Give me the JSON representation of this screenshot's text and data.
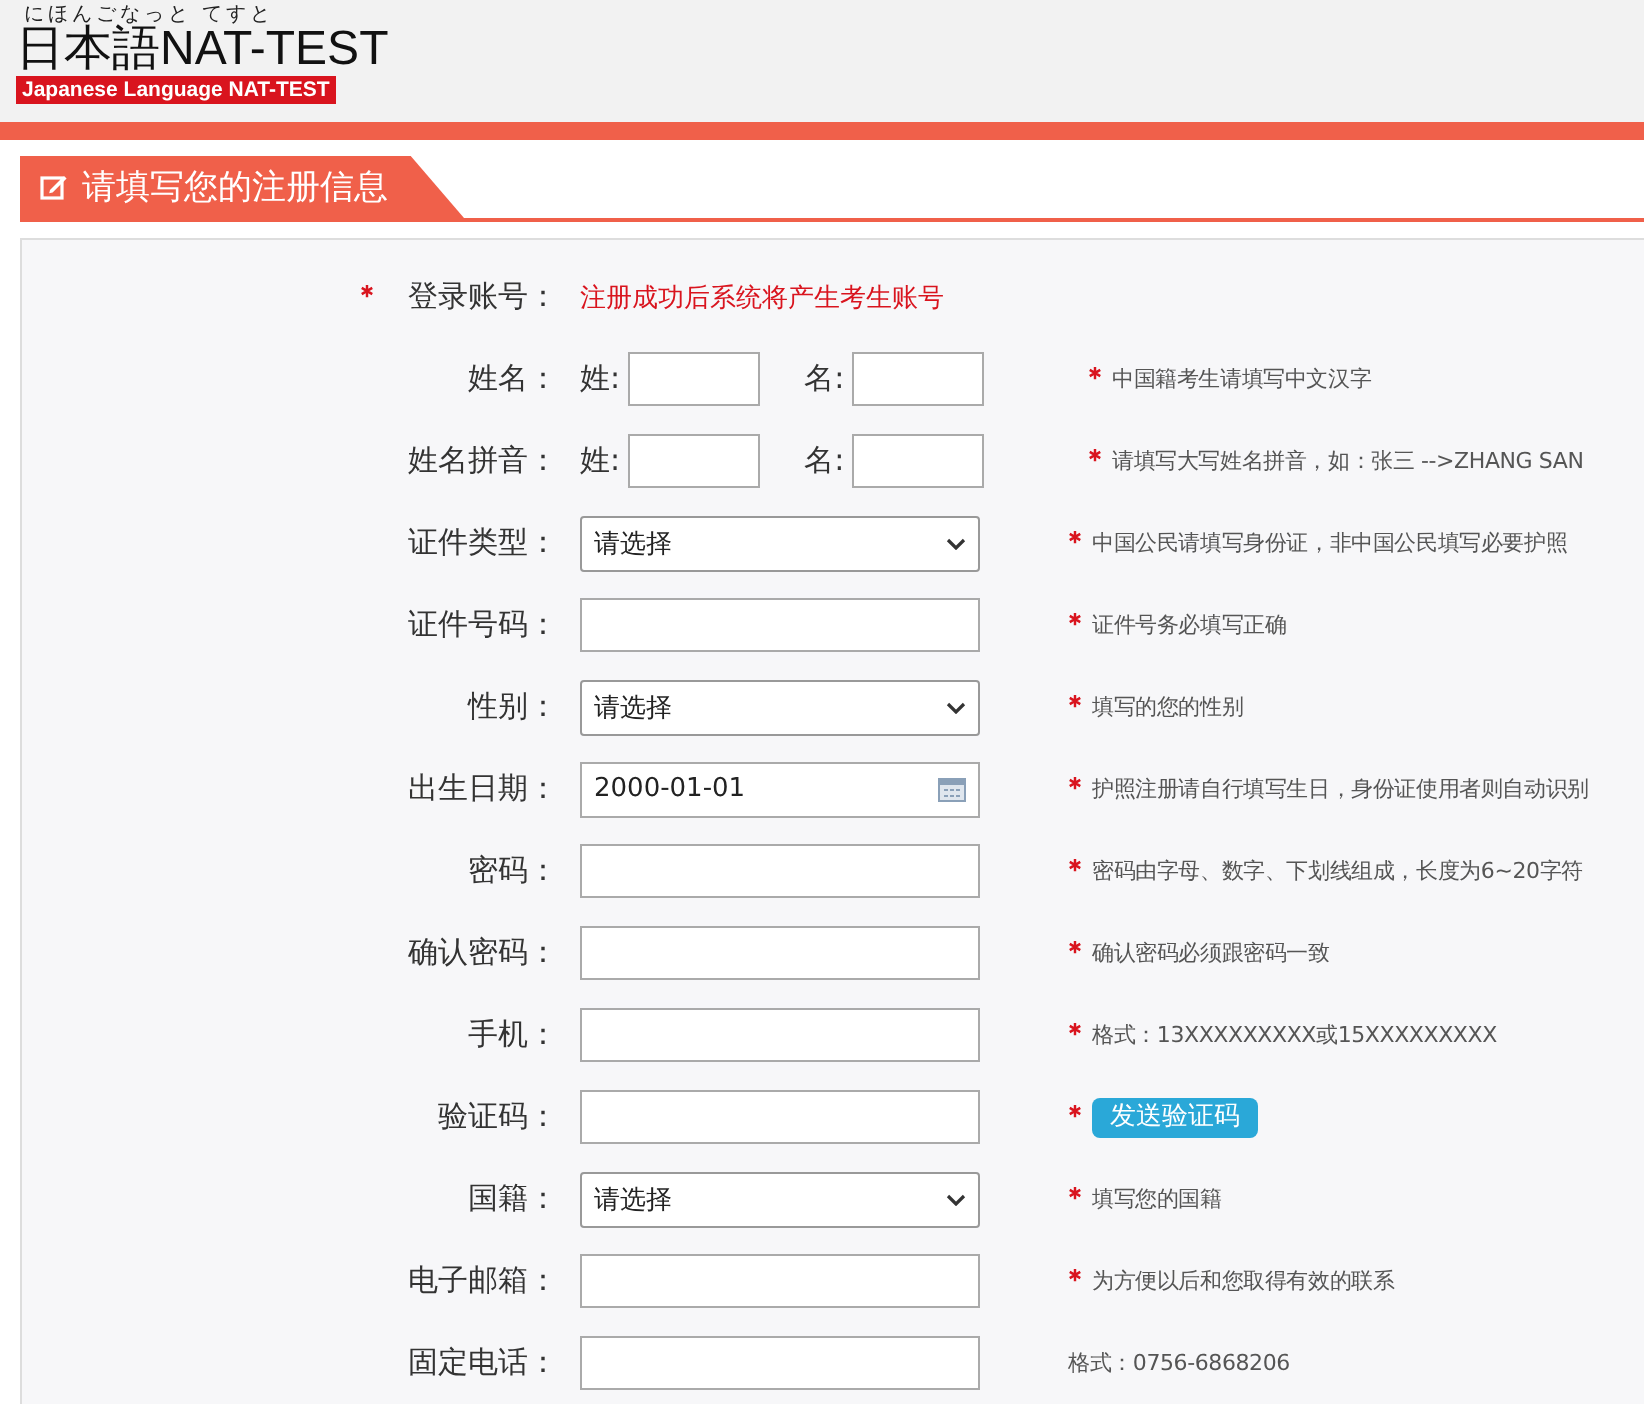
{
  "logo": {
    "ruby": "にほんごなっと てすと",
    "title": "日本語NAT-TEST",
    "subtitle": "Japanese Language NAT-TEST"
  },
  "section": {
    "title": "请填写您的注册信息"
  },
  "rows": [
    {
      "kind": "note",
      "label": "登录账号：",
      "starred": true,
      "note": "注册成功后系统将产生考生账号"
    },
    {
      "kind": "name",
      "label": "姓名：",
      "first": "姓:",
      "last": "名:",
      "hint": {
        "text": "中国籍考生请填写中文汉字",
        "required": true
      }
    },
    {
      "kind": "name",
      "label": "姓名拼音：",
      "first": "姓:",
      "last": "名:",
      "hint": {
        "text": "请填写大写姓名拼音，如：张三 -->ZHANG SAN",
        "required": true
      }
    },
    {
      "kind": "select",
      "label": "证件类型：",
      "value": "请选择",
      "hint": {
        "text": "中国公民请填写身份证，非中国公民填写必要护照",
        "required": true
      }
    },
    {
      "kind": "text",
      "label": "证件号码：",
      "hint": {
        "text": "证件号务必填写正确",
        "required": true
      }
    },
    {
      "kind": "select",
      "label": "性别：",
      "value": "请选择",
      "hint": {
        "text": "填写的您的性别",
        "required": true
      }
    },
    {
      "kind": "date",
      "label": "出生日期：",
      "value": "2000-01-01",
      "hint": {
        "text": "护照注册请自行填写生日，身份证使用者则自动识别",
        "required": true
      }
    },
    {
      "kind": "text",
      "label": "密码：",
      "hint": {
        "text": "密码由字母、数字、下划线组成，长度为6~20字符",
        "required": true
      }
    },
    {
      "kind": "text",
      "label": "确认密码：",
      "hint": {
        "text": "确认密码必须跟密码一致",
        "required": true
      }
    },
    {
      "kind": "text",
      "label": "手机：",
      "hint": {
        "text": "格式：13XXXXXXXXX或15XXXXXXXXX",
        "required": true
      }
    },
    {
      "kind": "text",
      "label": "验证码：",
      "button": "发送验证码",
      "hint": {
        "required": true
      }
    },
    {
      "kind": "select",
      "label": "国籍：",
      "value": "请选择",
      "hint": {
        "text": "填写您的国籍",
        "required": true
      }
    },
    {
      "kind": "text",
      "label": "电子邮箱：",
      "hint": {
        "text": "为方便以后和您取得有效的联系",
        "required": true
      }
    },
    {
      "kind": "text",
      "label": "固定电话：",
      "hint": {
        "text": "格式：0756-6868206",
        "required": false
      }
    }
  ]
}
